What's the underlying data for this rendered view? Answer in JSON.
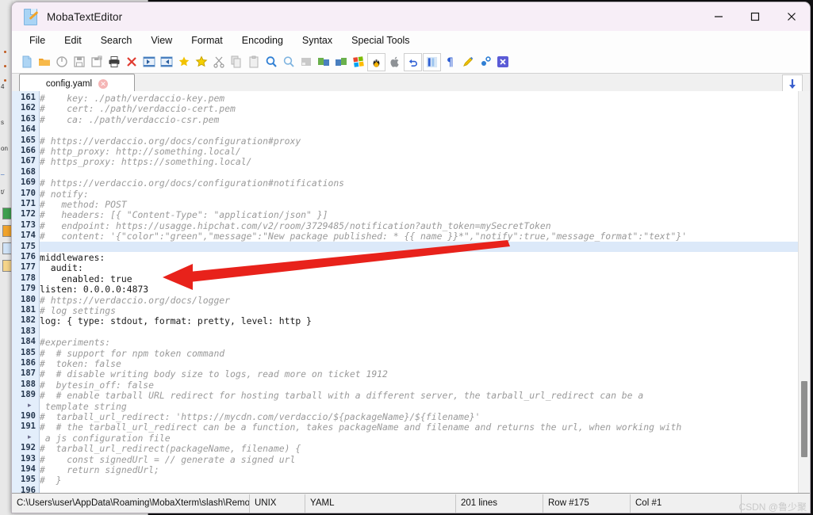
{
  "window": {
    "title": "MobaTextEditor",
    "icon": "text-document-pencil-icon",
    "controls": {
      "minimize": "—",
      "maximize": "□",
      "close": "✕"
    }
  },
  "menubar": {
    "items": [
      "File",
      "Edit",
      "Search",
      "View",
      "Format",
      "Encoding",
      "Syntax",
      "Special Tools"
    ]
  },
  "toolbar": {
    "items": [
      {
        "name": "new-file-icon",
        "title": "New"
      },
      {
        "name": "open-folder-icon",
        "title": "Open"
      },
      {
        "name": "reload-icon",
        "title": "Reload"
      },
      {
        "name": "save-icon",
        "title": "Save"
      },
      {
        "name": "save-as-icon",
        "title": "Save As"
      },
      {
        "name": "print-icon",
        "title": "Print"
      },
      {
        "name": "close-file-icon",
        "title": "Close"
      },
      {
        "name": "outdent-icon",
        "title": "Decrease indent"
      },
      {
        "name": "indent-icon",
        "title": "Increase indent"
      },
      {
        "name": "bookmark-add-icon",
        "title": "Add bookmark"
      },
      {
        "name": "bookmark-next-icon",
        "title": "Next bookmark"
      },
      {
        "name": "cut-icon",
        "title": "Cut"
      },
      {
        "name": "copy-icon",
        "title": "Copy"
      },
      {
        "name": "paste-icon",
        "title": "Paste"
      },
      {
        "name": "find-icon",
        "title": "Find"
      },
      {
        "name": "find-next-icon",
        "title": "Find next"
      },
      {
        "name": "block-icon",
        "title": "Block select"
      },
      {
        "name": "compare-left-icon",
        "title": "Compare"
      },
      {
        "name": "compare-right-icon",
        "title": "Merge"
      },
      {
        "name": "windows-format-icon",
        "title": "Windows format"
      },
      {
        "name": "linux-format-icon",
        "title": "Unix format"
      },
      {
        "name": "mac-format-icon",
        "title": "Mac format"
      },
      {
        "name": "undo-icon",
        "title": "Undo"
      },
      {
        "name": "column-mode-icon",
        "title": "Column mode"
      },
      {
        "name": "pilcrow-icon",
        "title": "Show invisible chars"
      },
      {
        "name": "highlight-pen-icon",
        "title": "Highlight"
      },
      {
        "name": "settings-icon",
        "title": "Settings"
      },
      {
        "name": "exit-icon",
        "title": "Exit"
      }
    ]
  },
  "tabs": {
    "active": "config.yaml",
    "close_glyph": "✕",
    "scroll_button": "scroll-down-icon"
  },
  "editor": {
    "first_line": 161,
    "highlight_line": 175,
    "lines": [
      {
        "n": 161,
        "text": "#    key: ./path/verdaccio-key.pem",
        "comment": true
      },
      {
        "n": 162,
        "text": "#    cert: ./path/verdaccio-cert.pem",
        "comment": true
      },
      {
        "n": 163,
        "text": "#    ca: ./path/verdaccio-csr.pem",
        "comment": true
      },
      {
        "n": 164,
        "text": "",
        "comment": false
      },
      {
        "n": 165,
        "text": "# https://verdaccio.org/docs/configuration#proxy",
        "comment": true
      },
      {
        "n": 166,
        "text": "# http_proxy: http://something.local/",
        "comment": true
      },
      {
        "n": 167,
        "text": "# https_proxy: https://something.local/",
        "comment": true
      },
      {
        "n": 168,
        "text": "",
        "comment": false
      },
      {
        "n": 169,
        "text": "# https://verdaccio.org/docs/configuration#notifications",
        "comment": true
      },
      {
        "n": 170,
        "text": "# notify:",
        "comment": true
      },
      {
        "n": 171,
        "text": "#   method: POST",
        "comment": true
      },
      {
        "n": 172,
        "text": "#   headers: [{ \"Content-Type\": \"application/json\" }]",
        "comment": true
      },
      {
        "n": 173,
        "text": "#   endpoint: https://usagge.hipchat.com/v2/room/3729485/notification?auth_token=mySecretToken",
        "comment": true
      },
      {
        "n": 174,
        "text": "#   content: '{\"color\":\"green\",\"message\":\"New package published: * {{ name }}*\",\"notify\":true,\"message_format\":\"text\"}'",
        "comment": true
      },
      {
        "n": 175,
        "text": "",
        "comment": false
      },
      {
        "n": 176,
        "text": "middlewares:",
        "comment": false
      },
      {
        "n": 177,
        "text": "  audit:",
        "comment": false
      },
      {
        "n": 178,
        "text": "    enabled: true",
        "comment": false
      },
      {
        "n": 179,
        "text": "listen: 0.0.0.0:4873",
        "comment": false
      },
      {
        "n": 180,
        "text": "# https://verdaccio.org/docs/logger",
        "comment": true
      },
      {
        "n": 181,
        "text": "# log settings",
        "comment": true
      },
      {
        "n": 182,
        "text": "log: { type: stdout, format: pretty, level: http }",
        "comment": false
      },
      {
        "n": 183,
        "text": "",
        "comment": false
      },
      {
        "n": 184,
        "text": "#experiments:",
        "comment": true
      },
      {
        "n": 185,
        "text": "#  # support for npm token command",
        "comment": true
      },
      {
        "n": 186,
        "text": "#  token: false",
        "comment": true
      },
      {
        "n": 187,
        "text": "#  # disable writing body size to logs, read more on ticket 1912",
        "comment": true
      },
      {
        "n": 188,
        "text": "#  bytesin_off: false",
        "comment": true
      },
      {
        "n": 189,
        "text": "#  # enable tarball URL redirect for hosting tarball with a different server, the tarball_url_redirect can be a",
        "comment": true,
        "wrap": " template string"
      },
      {
        "n": 190,
        "text": "#  tarball_url_redirect: 'https://mycdn.com/verdaccio/${packageName}/${filename}'",
        "comment": true
      },
      {
        "n": 191,
        "text": "#  # the tarball_url_redirect can be a function, takes packageName and filename and returns the url, when working with",
        "comment": true,
        "wrap": " a js configuration file"
      },
      {
        "n": 192,
        "text": "#  tarball_url_redirect(packageName, filename) {",
        "comment": true
      },
      {
        "n": 193,
        "text": "#    const signedUrl = // generate a signed url",
        "comment": true
      },
      {
        "n": 194,
        "text": "#    return signedUrl;",
        "comment": true
      },
      {
        "n": 195,
        "text": "#  }",
        "comment": true
      },
      {
        "n": 196,
        "text": "",
        "comment": false
      }
    ]
  },
  "statusbar": {
    "path": "C:\\Users\\user\\AppData\\Roaming\\MobaXterm\\slash\\RemoteFi",
    "eol": "UNIX",
    "syntax": "YAML",
    "lines": "201 lines",
    "row": "Row #175",
    "col": "Col #1"
  },
  "watermark": "CSDN @鲁少聚",
  "annotation": {
    "type": "red-arrow",
    "color": "#e8221b",
    "points_to_line": 179,
    "target_text": "listen: 0.0.0.0:4873"
  },
  "colors": {
    "titlebar": "#f7eef7",
    "gutter": "#e3eefb",
    "highlight": "#dce9f9",
    "comment": "#9a9a9a",
    "accent": "#3a5fcd"
  }
}
